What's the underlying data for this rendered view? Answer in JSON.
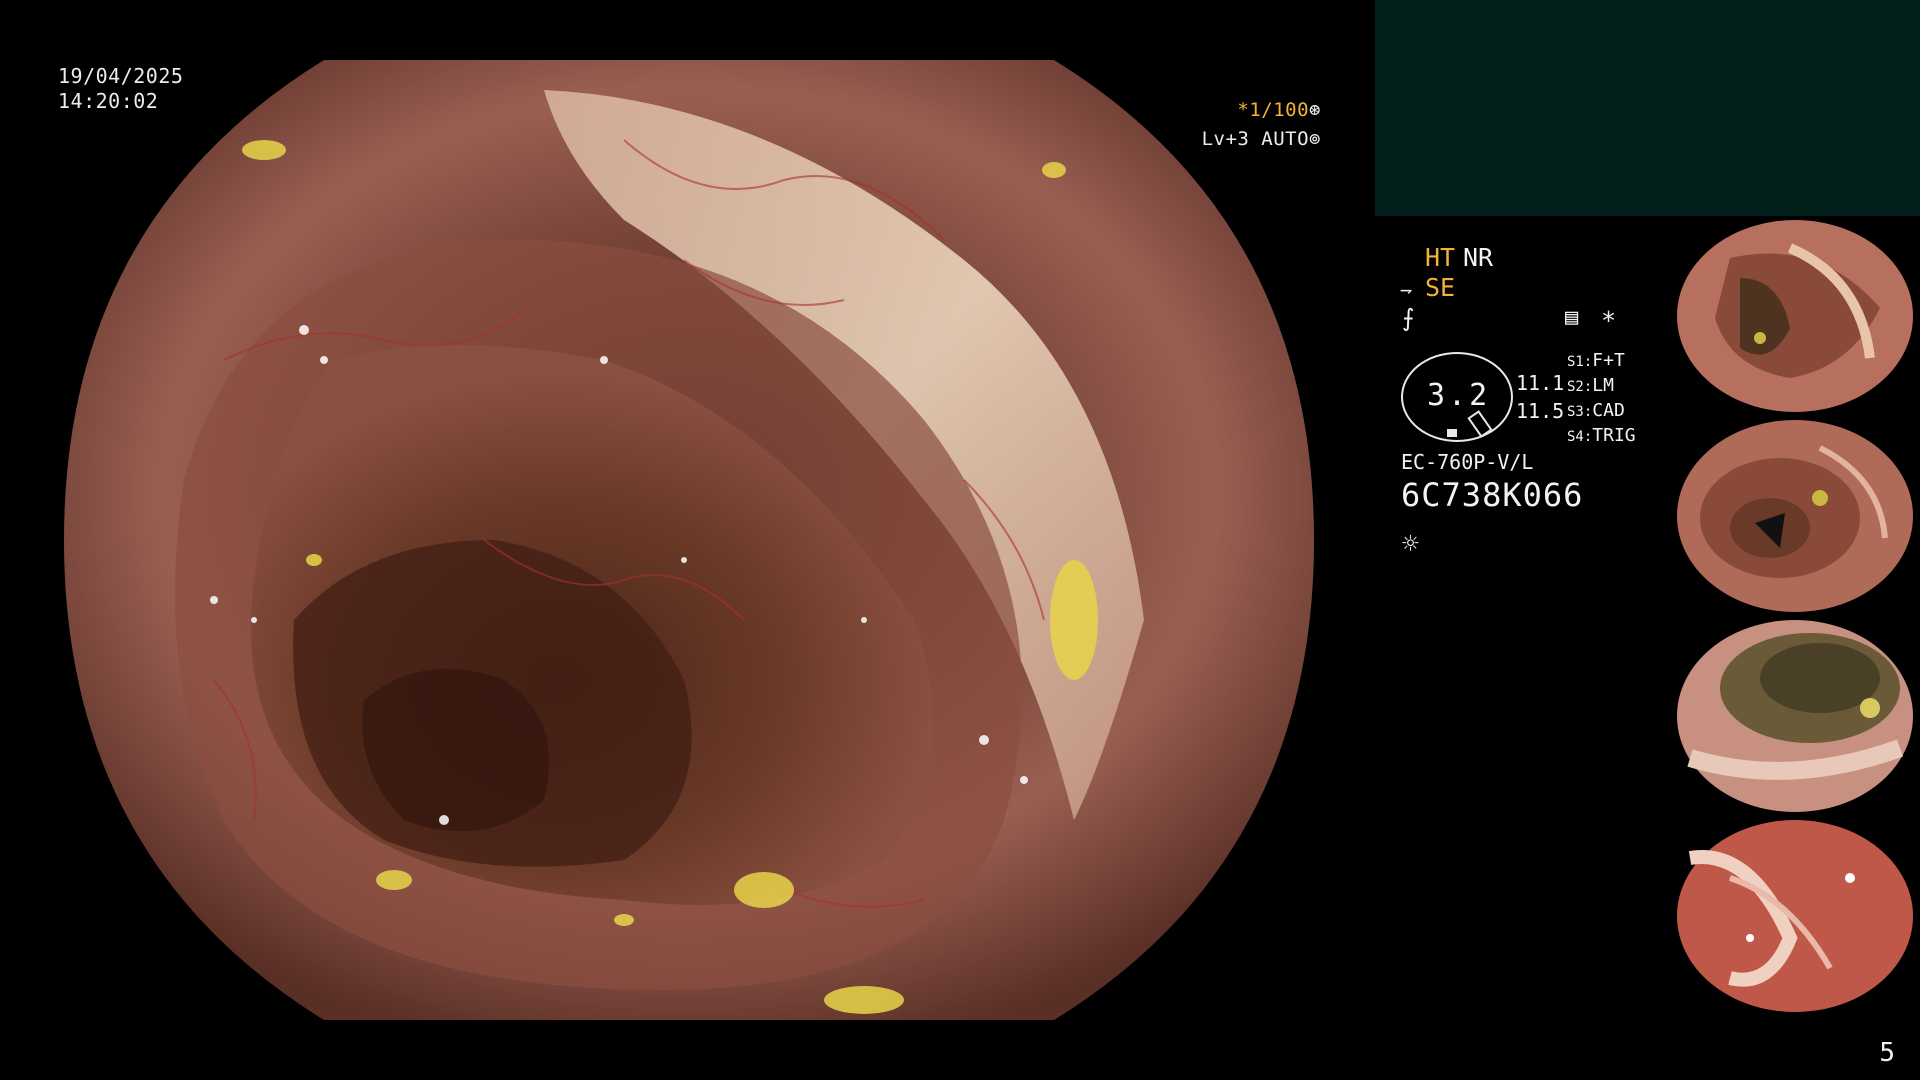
{
  "overlay": {
    "date": "19/04/2025",
    "time": "14:20:02",
    "zoom_prefix": "*1/100",
    "zoom_icon": "shutter-icon",
    "level": "Lv+3 AUTO",
    "level_icon": "iris-icon"
  },
  "info_panel": {
    "ht": "HT",
    "nr": "NR",
    "se": "SE",
    "se_icon": "structure-enhancement-icon",
    "freeze_icon": "freeze-icon",
    "memo_icon": "memo-icon",
    "asterisk": "*",
    "score": "3.2",
    "values": [
      "11.1",
      "11.5"
    ],
    "switches": [
      {
        "key": "S1:",
        "value": "F+T"
      },
      {
        "key": "S2:",
        "value": "LM"
      },
      {
        "key": "S3:",
        "value": "CAD"
      },
      {
        "key": "S4:",
        "value": "TRIG"
      }
    ],
    "model": "EC-760P-V/L",
    "serial": "6C738K066",
    "light_icon": "light-icon"
  },
  "thumbnails": [
    {
      "label": "thumbnail-1"
    },
    {
      "label": "thumbnail-2"
    },
    {
      "label": "thumbnail-3"
    },
    {
      "label": "thumbnail-4"
    }
  ],
  "page_number": "5",
  "colors": {
    "teal_panel": "#031f1c",
    "accent_orange": "#f2b233",
    "mucosa_dark": "#4a2820",
    "mucosa_light": "#b77a6a"
  }
}
